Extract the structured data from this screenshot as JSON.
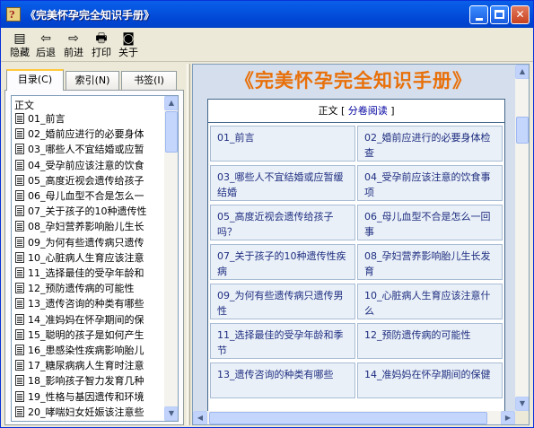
{
  "window": {
    "title": "《完美怀孕完全知识手册》",
    "controls": {
      "minimize": "",
      "maximize": "",
      "close": "✕"
    }
  },
  "toolbar": [
    {
      "label": "隐藏",
      "icon": "hide-icon",
      "glyph": "▤"
    },
    {
      "label": "后退",
      "icon": "back-arrow-icon",
      "glyph": "⇦"
    },
    {
      "label": "前进",
      "icon": "forward-arrow-icon",
      "glyph": "⇨"
    },
    {
      "label": "打印",
      "icon": "printer-icon",
      "glyph": "🖶"
    },
    {
      "label": "关于",
      "icon": "about-icon",
      "glyph": "◙"
    }
  ],
  "tabs": [
    {
      "label": "目录(C)",
      "active": true
    },
    {
      "label": "索引(N)",
      "active": false
    },
    {
      "label": "书签(I)",
      "active": false
    }
  ],
  "tree": {
    "root": "正文",
    "items": [
      "01_前言",
      "02_婚前应进行的必要身体",
      "03_哪些人不宜结婚或应暂",
      "04_受孕前应该注意的饮食",
      "05_高度近视会遗传给孩子",
      "06_母儿血型不合是怎么一",
      "07_关于孩子的10种遗传性",
      "08_孕妇营养影响胎儿生长",
      "09_为何有些遗传病只遗传",
      "10_心脏病人生育应该注意",
      "11_选择最佳的受孕年龄和",
      "12_预防遗传病的可能性",
      "13_遗传咨询的种类有哪些",
      "14_准妈妈在怀孕期间的保",
      "15_聪明的孩子是如何产生",
      "16_患感染性疾病影响胎儿",
      "17_糖尿病病人生育时注意",
      "18_影响孩子智力发育几种",
      "19_性格与基因遗传和环境",
      "20_哮喘妇女妊娠该注意些"
    ]
  },
  "content": {
    "title": "《完美怀孕完全知识手册》",
    "header_prefix": "正文 [ ",
    "header_link": "分卷阅读",
    "header_suffix": " ]",
    "cells": [
      "01_前言",
      "02_婚前应进行的必要身体检查",
      "03_哪些人不宜结婚或应暂缓结婚",
      "04_受孕前应该注意的饮食事项",
      "05_高度近视会遗传给孩子吗？",
      "06_母儿血型不合是怎么一回事",
      "07_关于孩子的10种遗传性疾病",
      "08_孕妇营养影响胎儿生长发育",
      "09_为何有些遗传病只遗传男性",
      "10_心脏病人生育应该注意什么",
      "11_选择最佳的受孕年龄和季节",
      "12_预防遗传病的可能性",
      "13_遗传咨询的种类有哪些",
      "14_准妈妈在怀孕期间的保健"
    ]
  },
  "colors": {
    "title_orange": "#E8700A",
    "link_blue": "#1E2E80",
    "titlebar": "#0453DE"
  }
}
